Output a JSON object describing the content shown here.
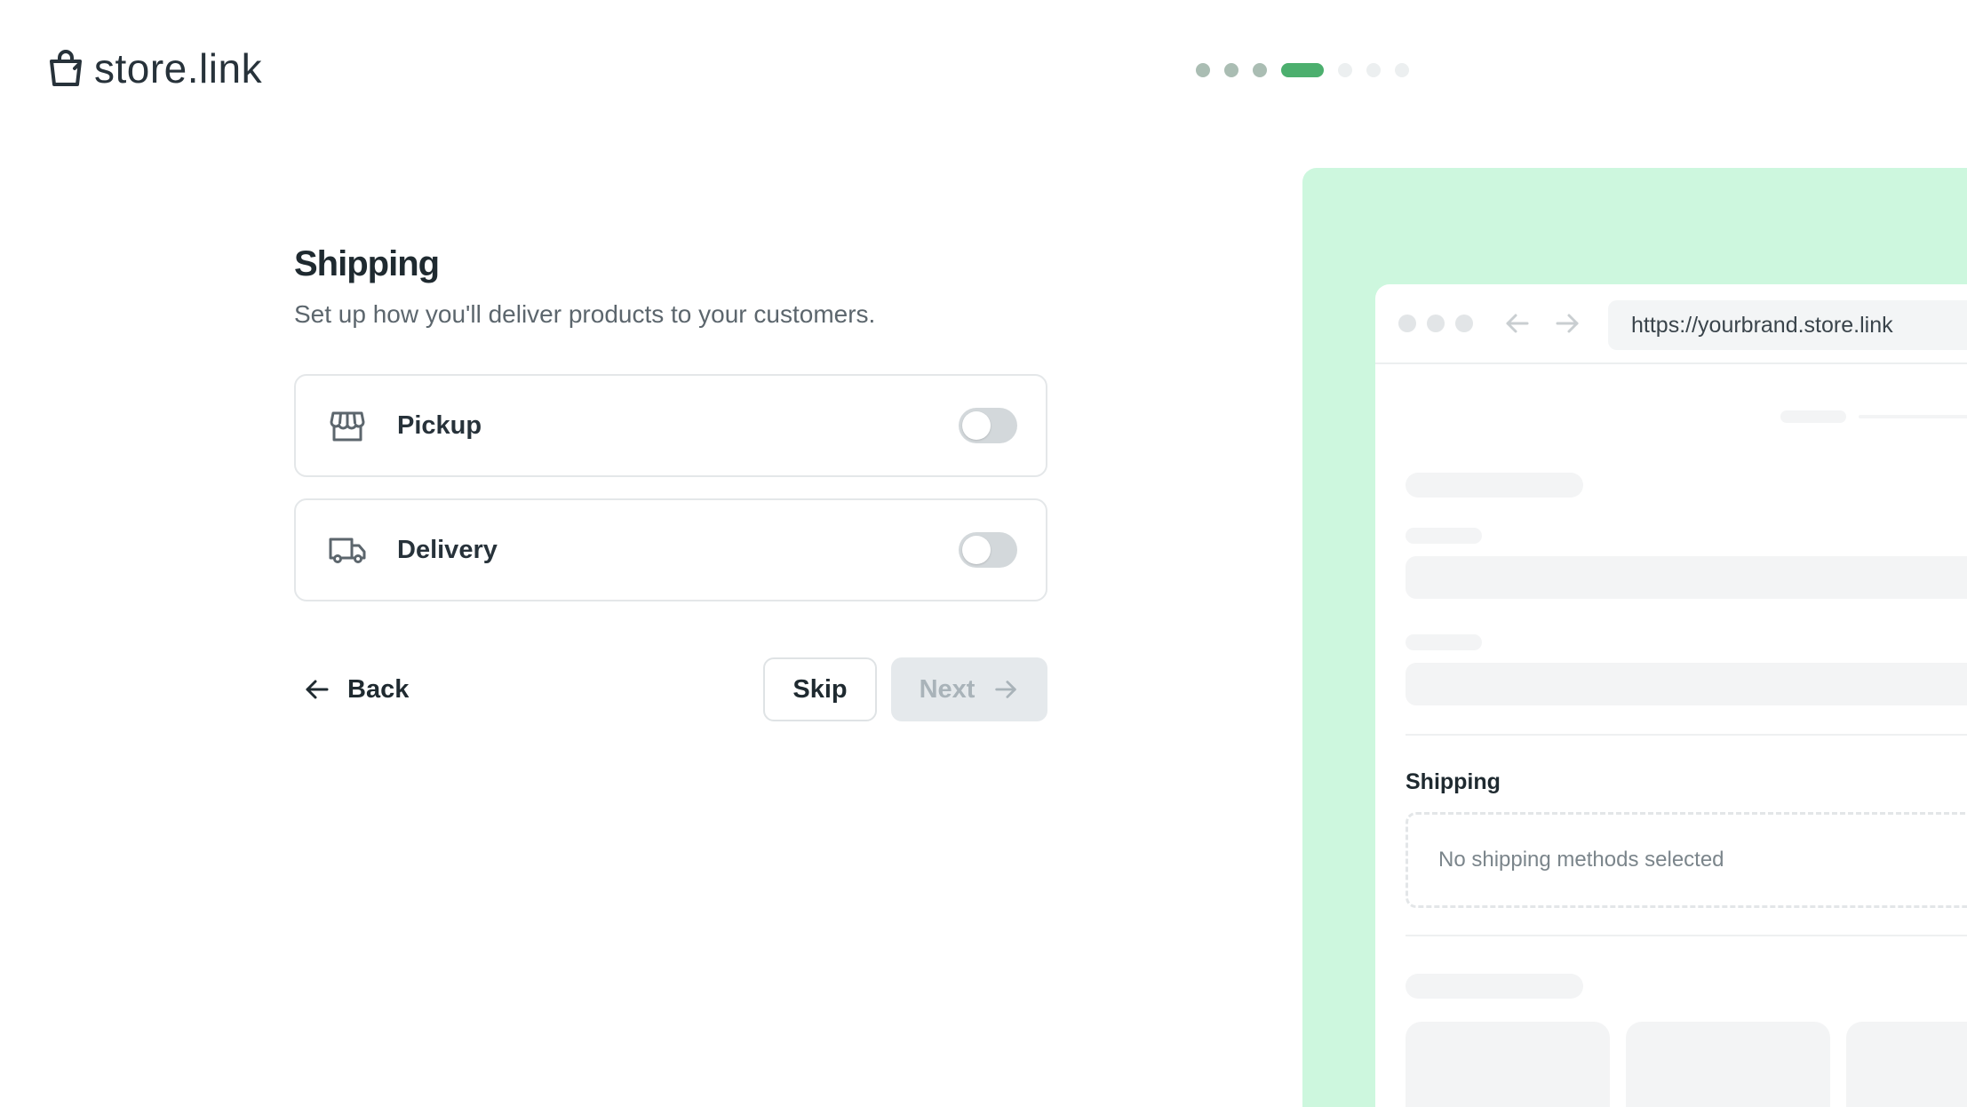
{
  "brand": {
    "name": "store.link"
  },
  "stepper": {
    "total": 7,
    "completed": 3,
    "current": 4
  },
  "form": {
    "title": "Shipping",
    "subtitle": "Set up how you'll deliver products to your customers.",
    "options": [
      {
        "label": "Pickup",
        "icon": "storefront-icon",
        "enabled": false
      },
      {
        "label": "Delivery",
        "icon": "truck-icon",
        "enabled": false
      }
    ],
    "actions": {
      "back_label": "Back",
      "skip_label": "Skip",
      "next_label": "Next"
    }
  },
  "preview": {
    "url": "https://yourbrand.store.link",
    "shipping_title": "Shipping",
    "empty_state": "No shipping methods selected"
  },
  "colors": {
    "accent": "#4caf6e",
    "preview_background": "#cdf7de"
  }
}
